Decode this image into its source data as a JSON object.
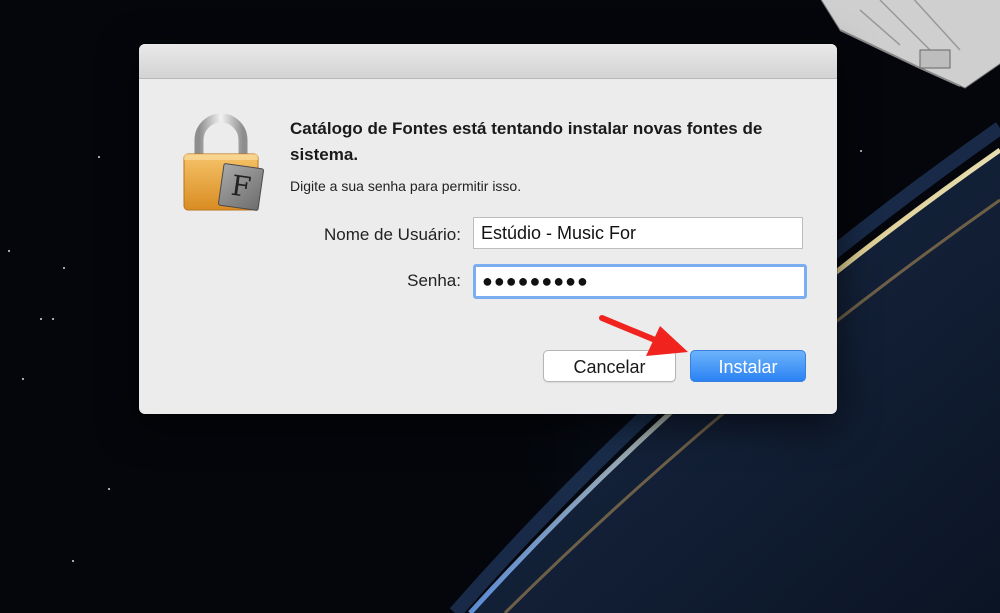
{
  "dialog": {
    "title": "Catálogo de Fontes está tentando instalar novas fontes de sistema.",
    "subtitle": "Digite a sua senha para permitir isso.",
    "icon": "lock-font-icon",
    "icon_letter": "F",
    "username_label": "Nome de Usuário:",
    "username_value": "Estúdio - Music For",
    "password_label": "Senha:",
    "password_value": "●●●●●●●●●",
    "cancel_label": "Cancelar",
    "install_label": "Instalar"
  },
  "annotation": {
    "icon": "red-arrow-icon",
    "color": "#f1231f"
  },
  "colors": {
    "accent": "#2b82f4",
    "focus_ring": "#7aaef0",
    "dialog_bg": "#ececec"
  }
}
